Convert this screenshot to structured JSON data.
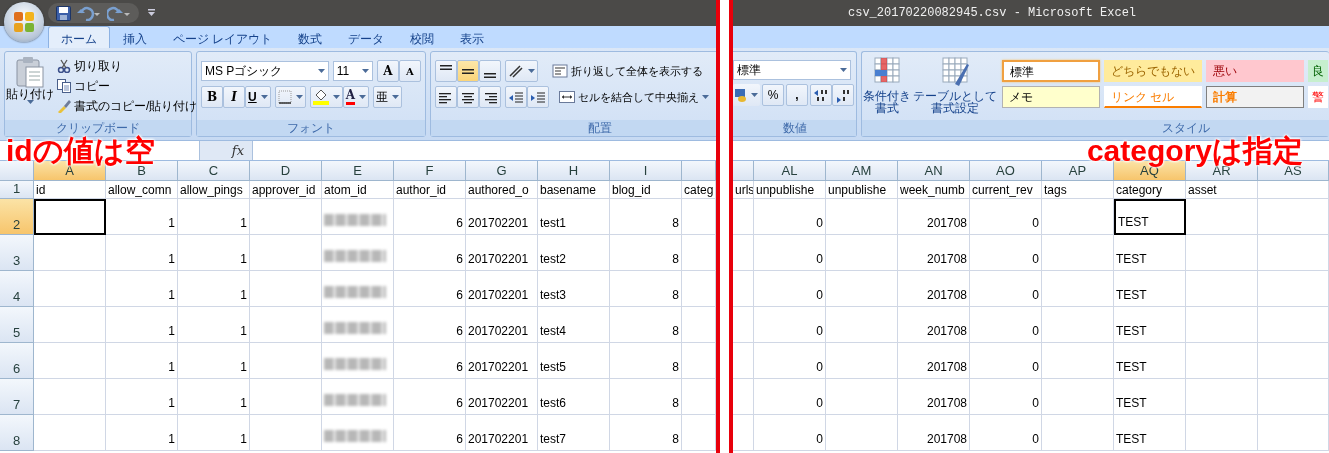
{
  "title_bar": {
    "title": "csv_20170220082945.csv - Microsoft Excel"
  },
  "tabs": [
    {
      "label": "ホーム",
      "selected": true
    },
    {
      "label": "挿入",
      "selected": false
    },
    {
      "label": "ページ レイアウト",
      "selected": false
    },
    {
      "label": "数式",
      "selected": false
    },
    {
      "label": "データ",
      "selected": false
    },
    {
      "label": "校閲",
      "selected": false
    },
    {
      "label": "表示",
      "selected": false
    }
  ],
  "clipboard_group": {
    "paste": "貼り付け",
    "cut": "切り取り",
    "copy": "コピー",
    "format_painter": "書式のコピー/貼り付け",
    "label": "クリップボード"
  },
  "font_group": {
    "font_name": "MS Pゴシック",
    "font_size": "11",
    "grow_font": "A",
    "shrink_font": "A",
    "bold": "B",
    "italic": "I",
    "underline": "U",
    "font_color": "A",
    "phonetic": "亜",
    "label": "フォント"
  },
  "alignment_group": {
    "wrap_text": "折り返して全体を表示する",
    "merge_center": "セルを結合して中央揃え",
    "label": "配置"
  },
  "number_group": {
    "format": "標準",
    "percent": "%",
    "comma": ",",
    "label": "数値"
  },
  "styles_group": {
    "conditional_formatting": [
      "条件付き",
      "書式"
    ],
    "format_as_table": [
      "テーブルとして",
      "書式設定"
    ],
    "label": "スタイル",
    "cell_styles": [
      {
        "label": "標準",
        "kind": "normal",
        "selected": true
      },
      {
        "label": "どちらでもない",
        "kind": "neutral",
        "selected": false
      },
      {
        "label": "悪い",
        "kind": "bad",
        "selected": false
      },
      {
        "label": "良",
        "kind": "good",
        "selected": false
      },
      {
        "label": "メモ",
        "kind": "note",
        "selected": false
      },
      {
        "label": "リンク セル",
        "kind": "link",
        "selected": false
      },
      {
        "label": "計算",
        "kind": "calc",
        "selected": false
      },
      {
        "label": "警",
        "kind": "warning",
        "selected": false
      }
    ]
  },
  "formula_bar": {
    "function_label": "fx"
  },
  "sheet_left": {
    "columns": [
      {
        "letter": "A",
        "selected": true,
        "kind": "text"
      },
      {
        "letter": "B",
        "selected": false,
        "kind": "number"
      },
      {
        "letter": "C",
        "selected": false,
        "kind": "number"
      },
      {
        "letter": "D",
        "selected": false,
        "kind": "number"
      },
      {
        "letter": "E",
        "selected": false,
        "kind": "text"
      },
      {
        "letter": "F",
        "selected": false,
        "kind": "number"
      },
      {
        "letter": "G",
        "selected": false,
        "kind": "text"
      },
      {
        "letter": "H",
        "selected": false,
        "kind": "text"
      },
      {
        "letter": "I",
        "selected": false,
        "kind": "number"
      },
      {
        "selected": false,
        "kind": "text"
      }
    ],
    "rows": [
      {
        "number": "1",
        "selected": false,
        "kind": "labels",
        "cells": [
          "id",
          "allow_comn",
          "allow_pings",
          "approver_id",
          "atom_id",
          "author_id",
          "authored_o",
          "basename",
          "blog_id",
          "categ"
        ]
      },
      {
        "number": "2",
        "selected": true,
        "kind": "records",
        "cells": [
          null,
          "1",
          "1",
          null,
          {
            "kind": "blurred"
          },
          "6",
          "201702201",
          "test1",
          "8",
          null
        ]
      },
      {
        "number": "3",
        "selected": false,
        "kind": "records",
        "cells": [
          null,
          "1",
          "1",
          null,
          {
            "kind": "blurred"
          },
          "6",
          "201702201",
          "test2",
          "8",
          null
        ]
      },
      {
        "number": "4",
        "selected": false,
        "kind": "records",
        "cells": [
          null,
          "1",
          "1",
          null,
          {
            "kind": "blurred"
          },
          "6",
          "201702201",
          "test3",
          "8",
          null
        ]
      },
      {
        "number": "5",
        "selected": false,
        "kind": "records",
        "cells": [
          null,
          "1",
          "1",
          null,
          {
            "kind": "blurred"
          },
          "6",
          "201702201",
          "test4",
          "8",
          null
        ]
      },
      {
        "number": "6",
        "selected": false,
        "kind": "records",
        "cells": [
          null,
          "1",
          "1",
          null,
          {
            "kind": "blurred"
          },
          "6",
          "201702201",
          "test5",
          "8",
          null
        ]
      },
      {
        "number": "7",
        "selected": false,
        "kind": "records",
        "cells": [
          null,
          "1",
          "1",
          null,
          {
            "kind": "blurred"
          },
          "6",
          "201702201",
          "test6",
          "8",
          null
        ]
      },
      {
        "number": "8",
        "selected": false,
        "kind": "records",
        "cells": [
          null,
          "1",
          "1",
          null,
          {
            "kind": "blurred"
          },
          "6",
          "201702201",
          "test7",
          "8",
          null
        ]
      }
    ]
  },
  "sheet_right": {
    "columns": [
      {
        "selected": false,
        "kind": "text"
      },
      {
        "letter": "AL",
        "selected": false,
        "kind": "number"
      },
      {
        "letter": "AM",
        "selected": false,
        "kind": "number"
      },
      {
        "letter": "AN",
        "selected": false,
        "kind": "number"
      },
      {
        "letter": "AO",
        "selected": false,
        "kind": "number"
      },
      {
        "letter": "AP",
        "selected": false,
        "kind": "text"
      },
      {
        "letter": "AQ",
        "selected": true,
        "kind": "text"
      },
      {
        "letter": "AR",
        "selected": false,
        "kind": "text"
      },
      {
        "letter": "AS",
        "selected": false,
        "kind": "text"
      }
    ],
    "rows": [
      {
        "kind": "labels",
        "cells": [
          "urls",
          "unpublishe",
          "unpublishe",
          "week_numb",
          "current_rev",
          "tags",
          "category",
          "asset",
          null
        ]
      },
      {
        "kind": "records",
        "cells": [
          null,
          "0",
          null,
          "201708",
          "0",
          null,
          "TEST",
          null,
          null
        ]
      },
      {
        "kind": "records",
        "cells": [
          null,
          "0",
          null,
          "201708",
          "0",
          null,
          "TEST",
          null,
          null
        ]
      },
      {
        "kind": "records",
        "cells": [
          null,
          "0",
          null,
          "201708",
          "0",
          null,
          "TEST",
          null,
          null
        ]
      },
      {
        "kind": "records",
        "cells": [
          null,
          "0",
          null,
          "201708",
          "0",
          null,
          "TEST",
          null,
          null
        ]
      },
      {
        "kind": "records",
        "cells": [
          null,
          "0",
          null,
          "201708",
          "0",
          null,
          "TEST",
          null,
          null
        ]
      },
      {
        "kind": "records",
        "cells": [
          null,
          "0",
          null,
          "201708",
          "0",
          null,
          "TEST",
          null,
          null
        ]
      },
      {
        "kind": "records",
        "cells": [
          null,
          "0",
          null,
          "201708",
          "0",
          null,
          "TEST",
          null,
          null
        ]
      }
    ]
  },
  "annotations": [
    {
      "text": "idの値は空"
    },
    {
      "text": "categoryは指定"
    }
  ]
}
